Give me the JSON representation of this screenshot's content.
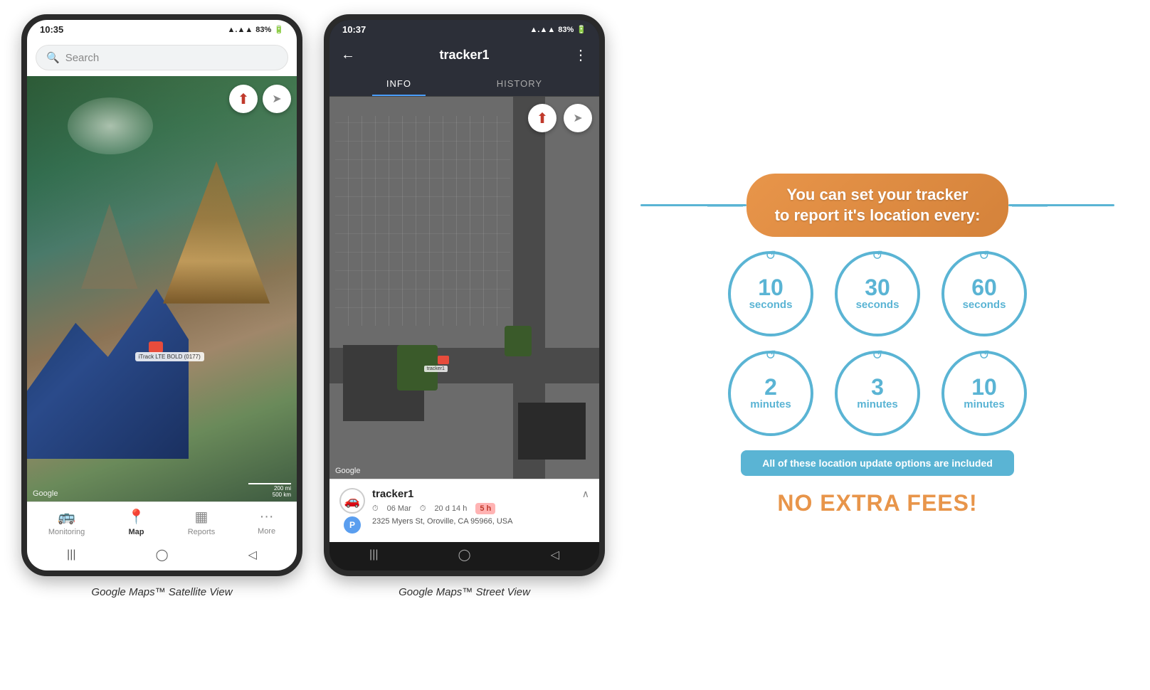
{
  "phone1": {
    "status_time": "10:35",
    "status_signal": "▲▲▲",
    "status_battery": "83%",
    "search_placeholder": "Search",
    "map_label": "iTrack LTE BOLD (0177)",
    "google_logo": "Google",
    "scale_mi": "200 mi",
    "scale_km": "500 km",
    "nav_items": [
      {
        "label": "Monitoring",
        "icon": "🚌"
      },
      {
        "label": "Map",
        "icon": "📍",
        "active": true
      },
      {
        "label": "Reports",
        "icon": "📊"
      },
      {
        "label": "More",
        "icon": "···"
      }
    ],
    "caption": "Google Maps™ Satellite View"
  },
  "phone2": {
    "status_time": "10:37",
    "status_signal": "▲▲▲",
    "status_battery": "83%",
    "back_icon": "←",
    "tracker_name": "tracker1",
    "menu_icon": "⋮",
    "tab_info": "INFO",
    "tab_history": "HISTORY",
    "google_logo": "Google",
    "tracker_info": {
      "name": "tracker1",
      "date": "06 Mar",
      "duration": "20 d 14 h",
      "address": "2325 Myers St, Oroville, CA 95966, USA",
      "badge": "5 h"
    },
    "caption": "Google Maps™ Street View"
  },
  "infographic": {
    "headline_line1": "You can set your tracker",
    "headline_line2": "to report it's location every:",
    "circles": [
      {
        "number": "10",
        "unit": "seconds"
      },
      {
        "number": "30",
        "unit": "seconds"
      },
      {
        "number": "60",
        "unit": "seconds"
      },
      {
        "number": "2",
        "unit": "minutes"
      },
      {
        "number": "3",
        "unit": "minutes"
      },
      {
        "number": "10",
        "unit": "minutes"
      }
    ],
    "banner_text": "All of these location update options are included",
    "no_fees": "NO EXTRA FEES!"
  }
}
